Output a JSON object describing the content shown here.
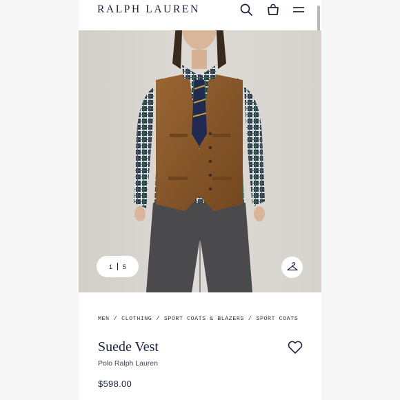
{
  "header": {
    "logo_text": "RALPH LAUREN",
    "icons": [
      "search-icon",
      "bag-icon",
      "menu-icon"
    ]
  },
  "gallery": {
    "current": "1",
    "total": "5",
    "icons": [
      "hanger-icon"
    ]
  },
  "breadcrumb": {
    "items": [
      "MEN",
      "CLOTHING",
      "SPORT COATS & BLAZERS",
      "SPORT COATS"
    ],
    "separator": "/"
  },
  "product": {
    "title": "Suede Vest",
    "brand": "Polo Ralph Lauren",
    "price": "$598.00",
    "icons": [
      "heart-icon"
    ]
  },
  "colors": {
    "brand_navy": "#1a2440",
    "backdrop": "#dad6d0",
    "vest_suede": "#8a5a2c",
    "trousers": "#4a4a4c"
  }
}
